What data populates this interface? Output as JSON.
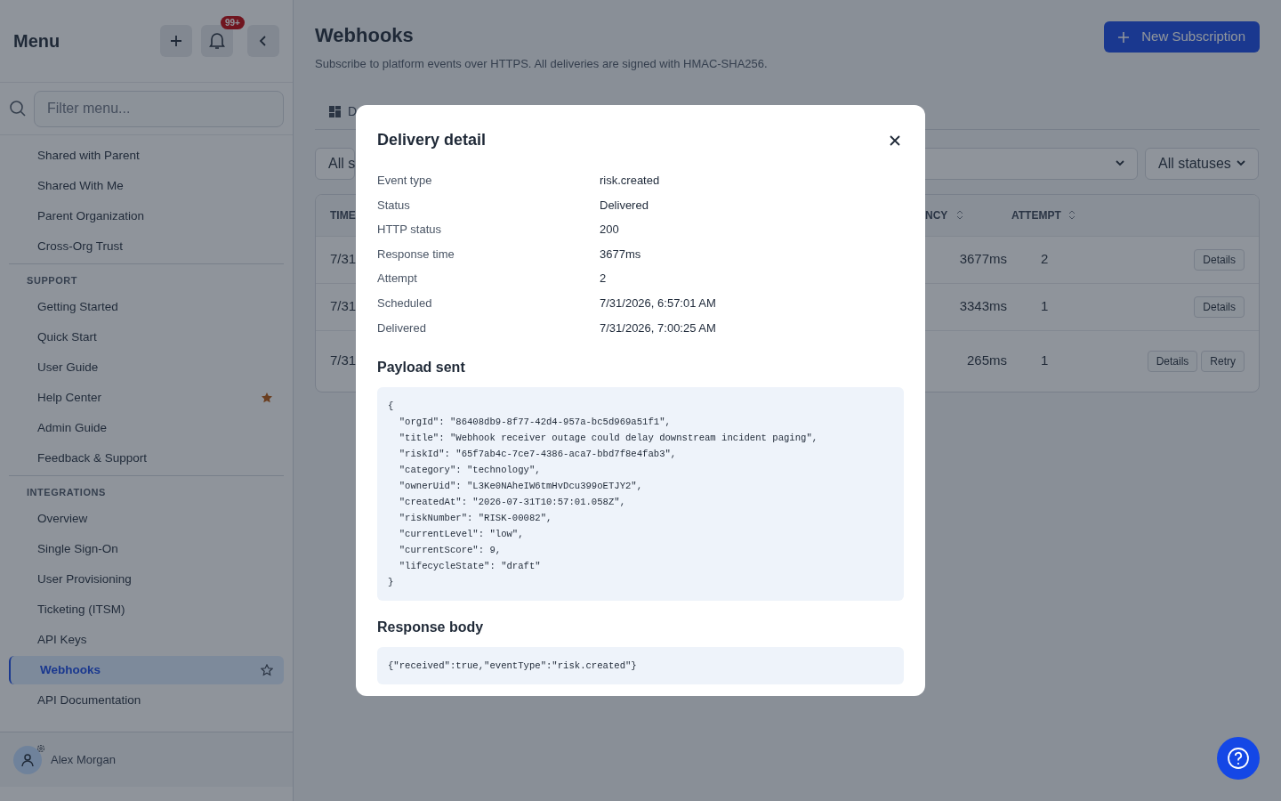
{
  "sidebar": {
    "title": "Menu",
    "notification_badge": "99+",
    "filter": {
      "placeholder": "Filter menu..."
    },
    "sections": [
      {
        "items": [
          {
            "label": "Shared with Parent",
            "selected": false,
            "starred": false
          },
          {
            "label": "Shared With Me",
            "selected": false,
            "starred": false
          },
          {
            "label": "Parent Organization",
            "selected": false,
            "starred": false
          },
          {
            "label": "Cross-Org Trust",
            "selected": false,
            "starred": false
          }
        ]
      },
      {
        "heading": "SUPPORT",
        "items": [
          {
            "label": "Getting Started",
            "selected": false,
            "starred": false
          },
          {
            "label": "Quick Start",
            "selected": false,
            "starred": false
          },
          {
            "label": "User Guide",
            "selected": false,
            "starred": false
          },
          {
            "label": "Help Center",
            "selected": false,
            "starred": true
          },
          {
            "label": "Admin Guide",
            "selected": false,
            "starred": false
          },
          {
            "label": "Feedback & Support",
            "selected": false,
            "starred": false
          }
        ]
      },
      {
        "heading": "INTEGRATIONS",
        "items": [
          {
            "label": "Overview",
            "selected": false,
            "starred": false
          },
          {
            "label": "Single Sign-On",
            "selected": false,
            "starred": false
          },
          {
            "label": "User Provisioning",
            "selected": false,
            "starred": false
          },
          {
            "label": "Ticketing (ITSM)",
            "selected": false,
            "starred": false
          },
          {
            "label": "API Keys",
            "selected": false,
            "starred": false
          },
          {
            "label": "Webhooks",
            "selected": true,
            "starred": false
          },
          {
            "label": "API Documentation",
            "selected": false,
            "starred": false
          }
        ]
      }
    ],
    "user": {
      "name": "Alex Morgan"
    }
  },
  "page": {
    "title": "Webhooks",
    "subtitle": "Subscribe to platform events over HTTPS. All deliveries are signed with HMAC-SHA256.",
    "primary_button": "New Subscription",
    "tabs": [
      {
        "label": "D",
        "selected": false
      }
    ],
    "filters": [
      {
        "value": "All s"
      },
      {
        "chevron": true
      },
      {
        "value": "All statuses",
        "chevron": true
      }
    ],
    "table": {
      "columns": {
        "column_1": "TIME",
        "column_2": "NCY",
        "column_3": "ATTEMPT"
      },
      "rows": [
        {
          "time": "7/31",
          "latency": "3677ms",
          "attempt": "2",
          "actions": [
            "Details"
          ]
        },
        {
          "time": "7/31",
          "latency": "3343ms",
          "attempt": "1",
          "actions": [
            "Details"
          ]
        },
        {
          "time": "7/31",
          "latency": "265ms",
          "attempt": "1",
          "actions": [
            "Details",
            "Retry"
          ]
        }
      ]
    }
  },
  "modal": {
    "title": "Delivery detail",
    "fields": [
      {
        "label": "Event type",
        "value": "risk.created"
      },
      {
        "label": "Status",
        "value": "Delivered"
      },
      {
        "label": "HTTP status",
        "value": "200"
      },
      {
        "label": "Response time",
        "value": "3677ms"
      },
      {
        "label": "Attempt",
        "value": "2"
      },
      {
        "label": "Scheduled",
        "value": "7/31/2026, 6:57:01 AM"
      },
      {
        "label": "Delivered",
        "value": "7/31/2026, 7:00:25 AM"
      }
    ],
    "payload_heading": "Payload sent",
    "payload": "{\n  \"orgId\": \"86408db9-8f77-42d4-957a-bc5d969a51f1\",\n  \"title\": \"Webhook receiver outage could delay downstream incident paging\",\n  \"riskId\": \"65f7ab4c-7ce7-4386-aca7-bbd7f8e4fab3\",\n  \"category\": \"technology\",\n  \"ownerUid\": \"L3Ke0NAheIW6tmHvDcu399oETJY2\",\n  \"createdAt\": \"2026-07-31T10:57:01.058Z\",\n  \"riskNumber\": \"RISK-00082\",\n  \"currentLevel\": \"low\",\n  \"currentScore\": 9,\n  \"lifecycleState\": \"draft\"\n}",
    "response_heading": "Response body",
    "response": "{\"received\":true,\"eventType\":\"risk.created\"}"
  }
}
